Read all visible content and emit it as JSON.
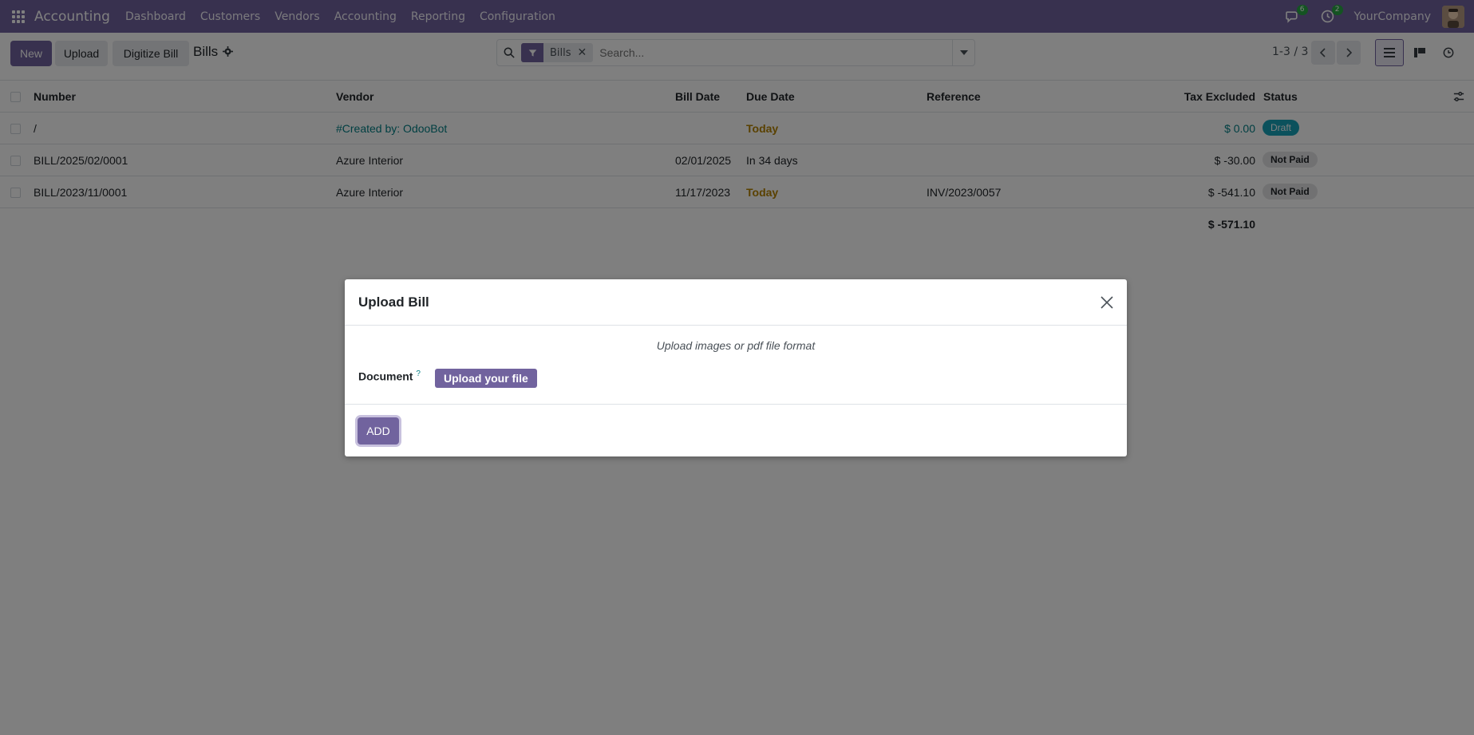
{
  "navbar": {
    "app_name": "Accounting",
    "menu": [
      "Dashboard",
      "Customers",
      "Vendors",
      "Accounting",
      "Reporting",
      "Configuration"
    ],
    "messages_count": "6",
    "activities_count": "2",
    "company": "YourCompany"
  },
  "control": {
    "new_label": "New",
    "upload_label": "Upload",
    "digitize_label": "Digitize Bill",
    "title": "Bills",
    "facet_label": "Bills",
    "search_placeholder": "Search...",
    "pager": "1-3 / 3"
  },
  "table": {
    "headers": {
      "number": "Number",
      "vendor": "Vendor",
      "bill_date": "Bill Date",
      "due_date": "Due Date",
      "reference": "Reference",
      "tax_excluded": "Tax Excluded",
      "status": "Status"
    },
    "rows": [
      {
        "number": "/",
        "vendor": "#Created by: OdooBot",
        "bill_date": "",
        "due_date": "Today",
        "reference": "",
        "tax_excluded": "$ 0.00",
        "status": "Draft"
      },
      {
        "number": "BILL/2025/02/0001",
        "vendor": "Azure Interior",
        "bill_date": "02/01/2025",
        "due_date": "In 34 days",
        "reference": "",
        "tax_excluded": "$ -30.00",
        "status": "Not Paid"
      },
      {
        "number": "BILL/2023/11/0001",
        "vendor": "Azure Interior",
        "bill_date": "11/17/2023",
        "due_date": "Today",
        "reference": "INV/2023/0057",
        "tax_excluded": "$ -541.10",
        "status": "Not Paid"
      }
    ],
    "total": "$ -571.10"
  },
  "modal": {
    "title": "Upload Bill",
    "hint": "Upload images or pdf file format",
    "document_label": "Document",
    "help_marker": "?",
    "upload_file_label": "Upload your file",
    "add_label": "ADD"
  },
  "colors": {
    "brand": "#71639e",
    "link": "#017e84",
    "draft": "#17a2b8",
    "warning": "#b58300"
  }
}
